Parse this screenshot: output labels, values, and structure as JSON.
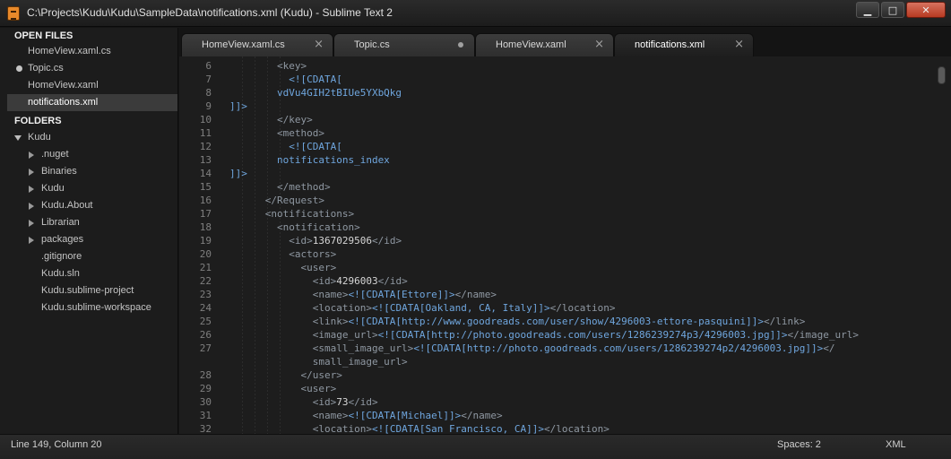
{
  "window": {
    "title": "C:\\Projects\\Kudu\\Kudu\\SampleData\\notifications.xml (Kudu) - Sublime Text 2",
    "minimize": "▁",
    "maximize": "□",
    "close": "✕"
  },
  "sidebar": {
    "open_files_header": "OPEN FILES",
    "open_files": [
      {
        "label": "HomeView.xaml.cs"
      },
      {
        "label": "Topic.cs",
        "modified": true
      },
      {
        "label": "HomeView.xaml"
      },
      {
        "label": "notifications.xml",
        "selected": true
      }
    ],
    "folders_header": "FOLDERS",
    "root": {
      "label": "Kudu",
      "expanded": true
    },
    "items": [
      {
        "label": ".nuget",
        "type": "folder"
      },
      {
        "label": "Binaries",
        "type": "folder"
      },
      {
        "label": "Kudu",
        "type": "folder"
      },
      {
        "label": "Kudu.About",
        "type": "folder"
      },
      {
        "label": "Librarian",
        "type": "folder"
      },
      {
        "label": "packages",
        "type": "folder"
      },
      {
        "label": ".gitignore",
        "type": "file"
      },
      {
        "label": "Kudu.sln",
        "type": "file"
      },
      {
        "label": "Kudu.sublime-project",
        "type": "file"
      },
      {
        "label": "Kudu.sublime-workspace",
        "type": "file"
      }
    ]
  },
  "tabs": [
    {
      "label": "HomeView.xaml.cs",
      "state": "close"
    },
    {
      "label": "Topic.cs",
      "state": "modified"
    },
    {
      "label": "HomeView.xaml",
      "state": "close"
    },
    {
      "label": "notifications.xml",
      "state": "close",
      "active": true
    }
  ],
  "editor": {
    "lines": [
      {
        "num": "6",
        "parts": [
          [
            "tag",
            "        <key>"
          ]
        ]
      },
      {
        "num": "7",
        "parts": [
          [
            "cdata",
            "          <![CDATA["
          ]
        ]
      },
      {
        "num": "8",
        "parts": [
          [
            "val",
            "        vdVu4GIH2tBIUe5YXbQkg"
          ]
        ]
      },
      {
        "num": "9",
        "parts": [
          [
            "cdata",
            "]]>"
          ]
        ]
      },
      {
        "num": "10",
        "parts": [
          [
            "tag",
            "        </key>"
          ]
        ]
      },
      {
        "num": "11",
        "parts": [
          [
            "tag",
            "        <method>"
          ]
        ]
      },
      {
        "num": "12",
        "parts": [
          [
            "cdata",
            "          <![CDATA["
          ]
        ]
      },
      {
        "num": "13",
        "parts": [
          [
            "val",
            "        notifications_index"
          ]
        ]
      },
      {
        "num": "14",
        "parts": [
          [
            "cdata",
            "]]>"
          ]
        ]
      },
      {
        "num": "15",
        "parts": [
          [
            "tag",
            "        </method>"
          ]
        ]
      },
      {
        "num": "16",
        "parts": [
          [
            "tag",
            "      </Request>"
          ]
        ]
      },
      {
        "num": "17",
        "parts": [
          [
            "tag",
            "      <notifications>"
          ]
        ]
      },
      {
        "num": "18",
        "parts": [
          [
            "tag",
            "        <notification>"
          ]
        ]
      },
      {
        "num": "19",
        "parts": [
          [
            "tag",
            "          <id>"
          ],
          [
            "txt",
            "1367029506"
          ],
          [
            "tag",
            "</id>"
          ]
        ]
      },
      {
        "num": "20",
        "parts": [
          [
            "tag",
            "          <actors>"
          ]
        ]
      },
      {
        "num": "21",
        "parts": [
          [
            "tag",
            "            <user>"
          ]
        ]
      },
      {
        "num": "22",
        "parts": [
          [
            "tag",
            "              <id>"
          ],
          [
            "txt",
            "4296003"
          ],
          [
            "tag",
            "</id>"
          ]
        ]
      },
      {
        "num": "23",
        "parts": [
          [
            "tag",
            "              <name>"
          ],
          [
            "cdata",
            "<![CDATA[Ettore]]>"
          ],
          [
            "tag",
            "</name>"
          ]
        ]
      },
      {
        "num": "24",
        "parts": [
          [
            "tag",
            "              <location>"
          ],
          [
            "cdata",
            "<![CDATA[Oakland, CA, Italy]]>"
          ],
          [
            "tag",
            "</location>"
          ]
        ]
      },
      {
        "num": "25",
        "parts": [
          [
            "tag",
            "              <link>"
          ],
          [
            "cdata",
            "<![CDATA[http://www.goodreads.com/user/show/4296003-ettore-pasquini]]>"
          ],
          [
            "tag",
            "</link>"
          ]
        ]
      },
      {
        "num": "26",
        "parts": [
          [
            "tag",
            "              <image_url>"
          ],
          [
            "cdata",
            "<![CDATA[http://photo.goodreads.com/users/1286239274p3/4296003.jpg]]>"
          ],
          [
            "tag",
            "</image_url>"
          ]
        ]
      },
      {
        "num": "27",
        "parts": [
          [
            "tag",
            "              <small_image_url>"
          ],
          [
            "cdata",
            "<![CDATA[http://photo.goodreads.com/users/1286239274p2/4296003.jpg]]>"
          ],
          [
            "tag",
            "</"
          ]
        ]
      },
      {
        "num": "",
        "parts": [
          [
            "tag",
            "              small_image_url>"
          ]
        ]
      },
      {
        "num": "28",
        "parts": [
          [
            "tag",
            "            </user>"
          ]
        ]
      },
      {
        "num": "29",
        "parts": [
          [
            "tag",
            "            <user>"
          ]
        ]
      },
      {
        "num": "30",
        "parts": [
          [
            "tag",
            "              <id>"
          ],
          [
            "txt",
            "73"
          ],
          [
            "tag",
            "</id>"
          ]
        ]
      },
      {
        "num": "31",
        "parts": [
          [
            "tag",
            "              <name>"
          ],
          [
            "cdata",
            "<![CDATA[Michael]]>"
          ],
          [
            "tag",
            "</name>"
          ]
        ]
      },
      {
        "num": "32",
        "parts": [
          [
            "tag",
            "              <location>"
          ],
          [
            "cdata",
            "<![CDATA[San Francisco, CA]]>"
          ],
          [
            "tag",
            "</location>"
          ]
        ]
      }
    ]
  },
  "statusbar": {
    "position": "Line 149, Column 20",
    "spaces": "Spaces: 2",
    "syntax": "XML"
  }
}
